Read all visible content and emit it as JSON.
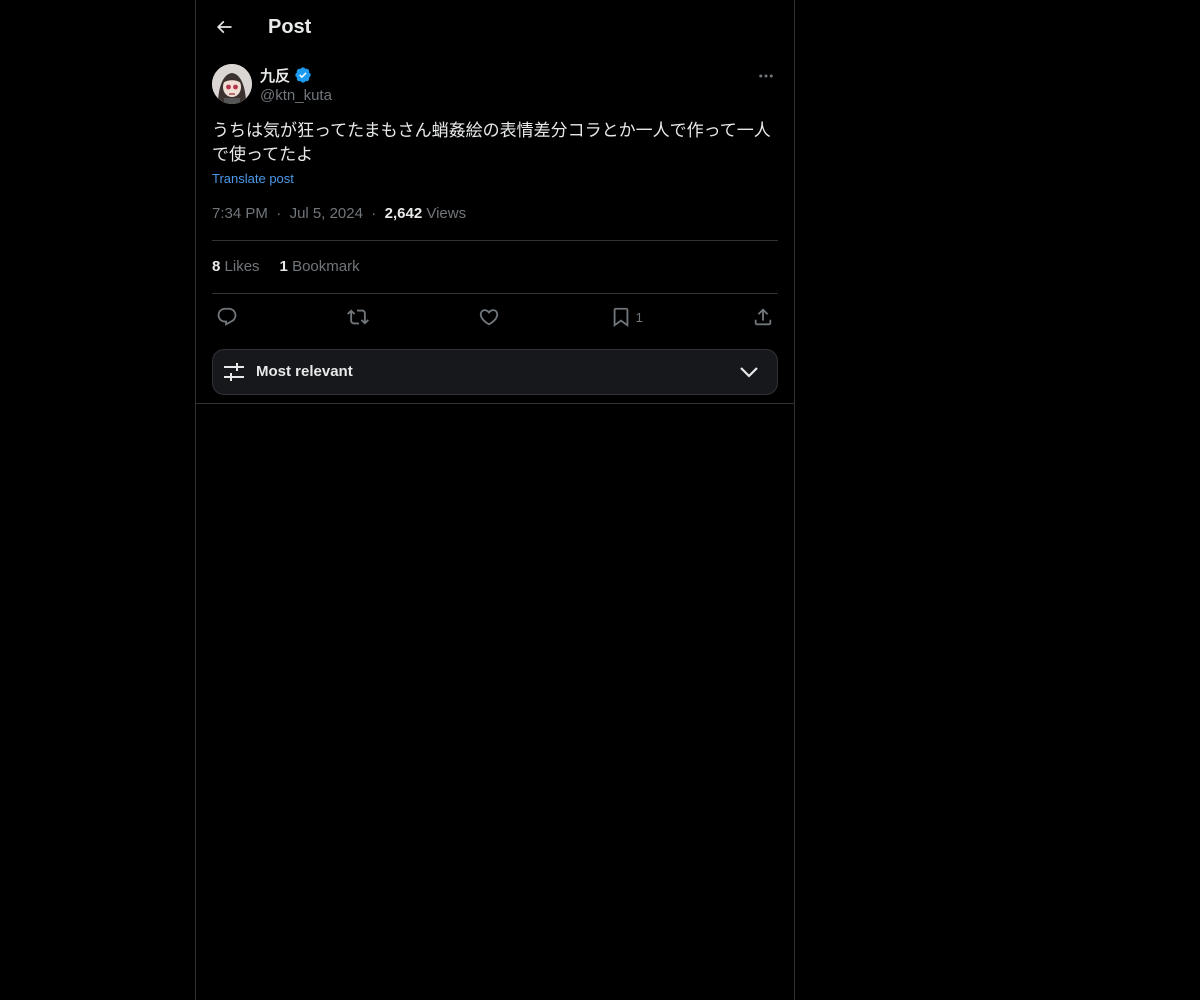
{
  "header": {
    "title": "Post"
  },
  "post": {
    "author": {
      "display_name": "九反",
      "handle": "@ktn_kuta",
      "verified": true,
      "verified_color": "#1d9bf0"
    },
    "text": "うちは気が狂ってたまもさん蛸姦絵の表情差分コラとか一人で作って一人で使ってたよ",
    "translate_label": "Translate post",
    "time": "7:34 PM",
    "date": "Jul 5, 2024",
    "views_count": "2,642",
    "views_label": "Views",
    "stats": {
      "likes_count": "8",
      "likes_label": "Likes",
      "bookmarks_count": "1",
      "bookmarks_label": "Bookmark"
    },
    "actions": {
      "bookmark_count": "1"
    }
  },
  "sort": {
    "label": "Most relevant"
  },
  "colors": {
    "background": "#000000",
    "text": "#e7e9ea",
    "muted": "#71767b",
    "link": "#4a99e9",
    "border": "#2f3336"
  }
}
